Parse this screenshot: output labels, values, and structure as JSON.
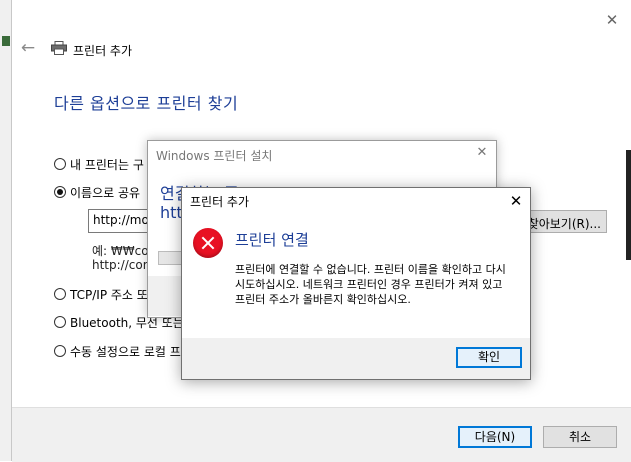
{
  "wizard": {
    "nav_title": "프린터 추가",
    "heading": "다른 옵션으로 프린터 찾기",
    "options": [
      {
        "label": "내 프린터는 구",
        "selected": false
      },
      {
        "label": "이름으로 공유",
        "selected": true
      },
      {
        "label": "TCP/IP 주소 또",
        "selected": false
      },
      {
        "label": "Bluetooth, 무선 또는",
        "selected": false
      },
      {
        "label": "수동 설정으로 로컬 프",
        "selected": false
      }
    ],
    "share_input_value": "http://mo",
    "browse_label": "찾아보기(R)...",
    "example_line1": "예: ₩₩com",
    "example_line2": "http://com",
    "next_label": "다음(N)",
    "cancel_label": "취소"
  },
  "install_dialog": {
    "title": "Windows 프린터 설치",
    "heading": "연결하는 중",
    "sub": "htt"
  },
  "error_dialog": {
    "title": "프린터 추가",
    "heading": "프린터 연결",
    "message": "프린터에 연결할 수 없습니다. 프린터 이름을 확인하고 다시 시도하십시오. 네트워크 프린터인 경우 프린터가 켜져 있고 프린터 주소가 올바른지 확인하십시오.",
    "ok_label": "확인"
  },
  "colors": {
    "heading_blue": "#1e3f97",
    "error_red": "#e81123",
    "focus_blue": "#0078d7"
  },
  "icons": [
    "back-arrow-icon",
    "printer-icon",
    "close-icon",
    "error-icon"
  ]
}
